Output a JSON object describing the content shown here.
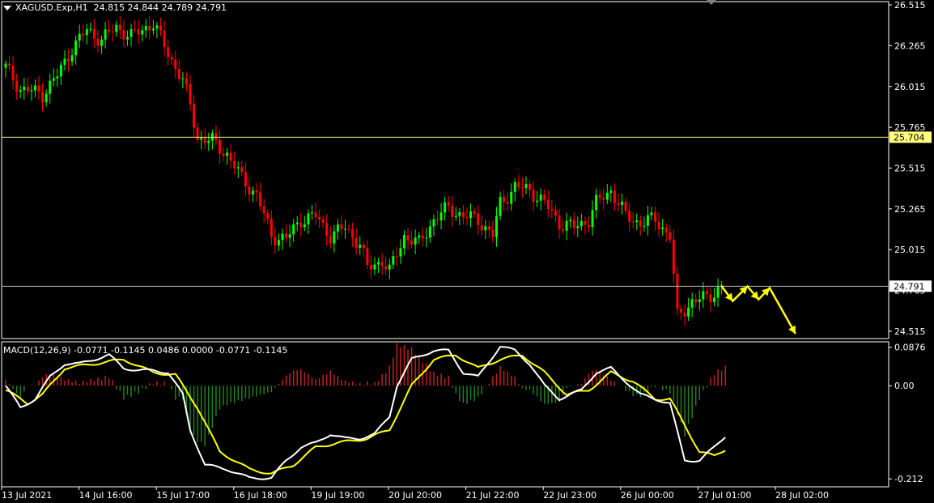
{
  "header": {
    "symbol": "XAGUSD.Exp,H1",
    "ohlc": "24.815 24.844 24.789 24.791"
  },
  "macd": {
    "label": "MACD(12,26,9) -0.0771 -0.1145 0.0486 0.0000 -0.0771 -0.1145"
  },
  "colors": {
    "background": "#000000",
    "bull": "#00ff00",
    "bear": "#ff0000",
    "hline": "#c8c8c8",
    "current_line": "#c0c0c0",
    "level_line": "#ffff80",
    "macd_line": "#ffffff",
    "signal_line": "#ffff00",
    "hist_pos": "#c02020",
    "hist_neg": "#208020",
    "arrows": "#ffff00"
  },
  "chart_data": [
    {
      "type": "candlestick",
      "panel": "price",
      "yticks": [
        "26.515",
        "26.265",
        "26.015",
        "25.765",
        "25.515",
        "25.265",
        "25.015",
        "24.765",
        "24.515"
      ],
      "ytick_values": [
        26.515,
        26.265,
        26.015,
        25.765,
        25.515,
        25.265,
        25.015,
        24.765,
        24.515
      ],
      "ylim": [
        24.47,
        26.535
      ],
      "price_tags": [
        {
          "label": "25.704",
          "value": 25.704,
          "style": "level"
        },
        {
          "label": "24.791",
          "value": 24.791,
          "style": "current"
        }
      ],
      "anchors": [
        [
          0,
          26.13
        ],
        [
          4,
          26.0
        ],
        [
          10,
          25.97
        ],
        [
          14,
          26.08
        ],
        [
          18,
          26.25
        ],
        [
          22,
          26.36
        ],
        [
          26,
          26.3
        ],
        [
          30,
          26.38
        ],
        [
          34,
          26.32
        ],
        [
          38,
          26.38
        ],
        [
          40,
          26.4
        ],
        [
          44,
          26.22
        ],
        [
          48,
          26.05
        ],
        [
          50,
          25.9
        ],
        [
          52,
          25.7
        ],
        [
          56,
          25.68
        ],
        [
          60,
          25.6
        ],
        [
          64,
          25.45
        ],
        [
          68,
          25.35
        ],
        [
          72,
          25.1
        ],
        [
          76,
          25.08
        ],
        [
          80,
          25.2
        ],
        [
          84,
          25.22
        ],
        [
          88,
          25.1
        ],
        [
          92,
          25.15
        ],
        [
          96,
          25.05
        ],
        [
          98,
          24.9
        ],
        [
          102,
          24.95
        ],
        [
          104,
          24.88
        ],
        [
          108,
          25.1
        ],
        [
          112,
          25.05
        ],
        [
          116,
          25.2
        ],
        [
          120,
          25.27
        ],
        [
          124,
          25.22
        ],
        [
          128,
          25.2
        ],
        [
          132,
          25.1
        ],
        [
          134,
          25.3
        ],
        [
          138,
          25.4
        ],
        [
          142,
          25.38
        ],
        [
          146,
          25.3
        ],
        [
          150,
          25.18
        ],
        [
          154,
          25.15
        ],
        [
          158,
          25.2
        ],
        [
          160,
          25.3
        ],
        [
          164,
          25.38
        ],
        [
          168,
          25.22
        ],
        [
          172,
          25.18
        ],
        [
          176,
          25.2
        ],
        [
          180,
          25.1
        ],
        [
          182,
          24.6
        ],
        [
          186,
          24.7
        ],
        [
          190,
          24.72
        ],
        [
          194,
          24.79
        ]
      ],
      "projection_arrows": [
        [
          [
            194,
            24.791
          ],
          [
            197,
            24.7
          ],
          [
            201,
            24.79
          ],
          [
            204,
            24.71
          ],
          [
            207,
            24.78
          ],
          [
            214,
            24.5
          ]
        ]
      ],
      "xticks": [
        "13 Jul 2021",
        "14 Jul 16:00",
        "15 Jul 17:00",
        "16 Jul 18:00",
        "19 Jul 19:00",
        "20 Jul 20:00",
        "21 Jul 22:00",
        "22 Jul 23:00",
        "26 Jul 00:00",
        "27 Jul 01:00",
        "28 Jul 02:00"
      ]
    },
    {
      "type": "macd",
      "panel": "indicator",
      "yticks": [
        "0.0876",
        "0.00",
        "-0.212"
      ],
      "ytick_values": [
        0.0876,
        0.0,
        -0.212
      ],
      "ylim": [
        -0.23,
        0.1
      ],
      "macd_anchors": [
        [
          0,
          0.0
        ],
        [
          4,
          -0.05
        ],
        [
          8,
          -0.03
        ],
        [
          12,
          0.02
        ],
        [
          16,
          0.05
        ],
        [
          20,
          0.05
        ],
        [
          24,
          0.06
        ],
        [
          28,
          0.07
        ],
        [
          32,
          0.04
        ],
        [
          36,
          0.035
        ],
        [
          40,
          0.035
        ],
        [
          44,
          0.03
        ],
        [
          48,
          -0.02
        ],
        [
          50,
          -0.1
        ],
        [
          54,
          -0.18
        ],
        [
          60,
          -0.19
        ],
        [
          66,
          -0.21
        ],
        [
          72,
          -0.21
        ],
        [
          76,
          -0.17
        ],
        [
          80,
          -0.14
        ],
        [
          84,
          -0.13
        ],
        [
          88,
          -0.11
        ],
        [
          92,
          -0.12
        ],
        [
          96,
          -0.12
        ],
        [
          100,
          -0.11
        ],
        [
          104,
          -0.07
        ],
        [
          106,
          0.0
        ],
        [
          110,
          0.06
        ],
        [
          116,
          0.08
        ],
        [
          120,
          0.08
        ],
        [
          124,
          0.03
        ],
        [
          128,
          0.02
        ],
        [
          134,
          0.09
        ],
        [
          138,
          0.08
        ],
        [
          142,
          0.05
        ],
        [
          146,
          0.0
        ],
        [
          150,
          -0.03
        ],
        [
          156,
          -0.01
        ],
        [
          160,
          0.03
        ],
        [
          164,
          0.04
        ],
        [
          168,
          0.01
        ],
        [
          172,
          -0.02
        ],
        [
          176,
          -0.03
        ],
        [
          180,
          -0.04
        ],
        [
          184,
          -0.17
        ],
        [
          188,
          -0.17
        ],
        [
          192,
          -0.14
        ],
        [
          195,
          -0.1145
        ]
      ],
      "signal_anchors": [
        [
          0,
          -0.01
        ],
        [
          6,
          -0.04
        ],
        [
          10,
          -0.02
        ],
        [
          16,
          0.04
        ],
        [
          24,
          0.05
        ],
        [
          32,
          0.06
        ],
        [
          40,
          0.03
        ],
        [
          46,
          0.025
        ],
        [
          52,
          -0.05
        ],
        [
          58,
          -0.15
        ],
        [
          66,
          -0.19
        ],
        [
          72,
          -0.2
        ],
        [
          78,
          -0.18
        ],
        [
          84,
          -0.14
        ],
        [
          90,
          -0.13
        ],
        [
          98,
          -0.12
        ],
        [
          104,
          -0.1
        ],
        [
          110,
          0.0
        ],
        [
          116,
          0.06
        ],
        [
          122,
          0.07
        ],
        [
          128,
          0.04
        ],
        [
          134,
          0.06
        ],
        [
          140,
          0.07
        ],
        [
          146,
          0.03
        ],
        [
          152,
          -0.02
        ],
        [
          158,
          -0.01
        ],
        [
          164,
          0.03
        ],
        [
          170,
          0.01
        ],
        [
          176,
          -0.03
        ],
        [
          180,
          -0.03
        ],
        [
          184,
          -0.09
        ],
        [
          188,
          -0.15
        ],
        [
          192,
          -0.16
        ],
        [
          195,
          -0.145
        ]
      ]
    }
  ]
}
